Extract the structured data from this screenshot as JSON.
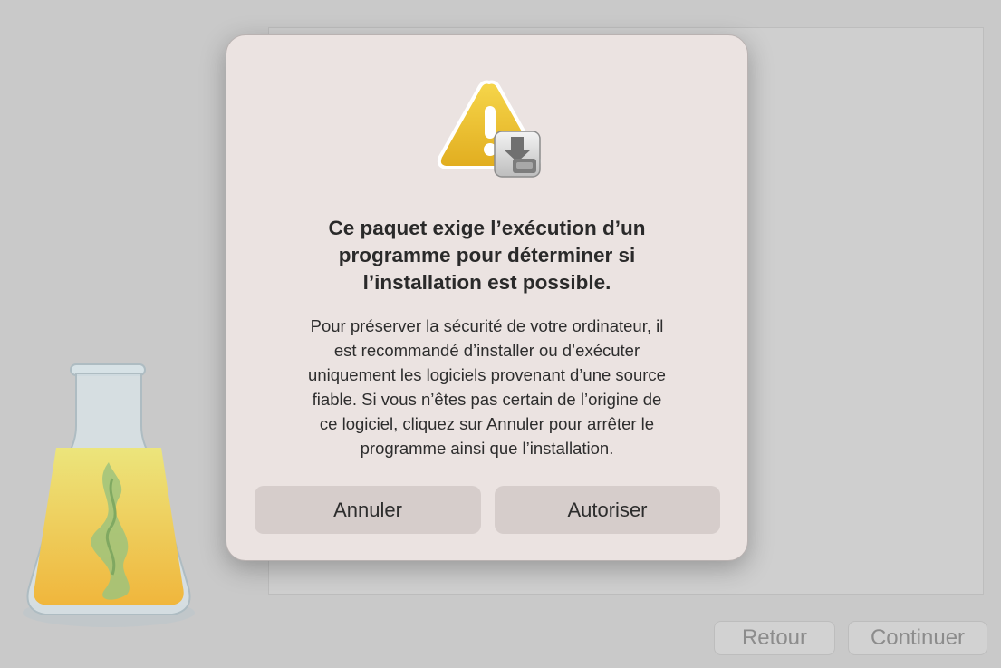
{
  "window": {
    "back_label": "Retour",
    "continue_label": "Continuer"
  },
  "dialog": {
    "title": "Ce paquet exige l’exécution d’un\nprogramme pour déterminer si\nl’installation est possible.",
    "message": "Pour préserver la sécurité de votre ordinateur, il\nest recommandé d’installer ou d’exécuter\nuniquement les logiciels provenant d’une source\nfiable. Si vous n’êtes pas certain de l’origine de\nce logiciel, cliquez sur Annuler pour arrêter le\nprogramme ainsi que l’installation.",
    "cancel_label": "Annuler",
    "allow_label": "Autoriser"
  },
  "icons": {
    "dialog_icon": "warning-triangle-with-installer-disk-icon",
    "app_icon": "installer-flask-icon"
  },
  "colors": {
    "dialog_background": "#ebe3e1",
    "button_background": "#d6cdcb",
    "warning_yellow": "#f0c52a"
  }
}
